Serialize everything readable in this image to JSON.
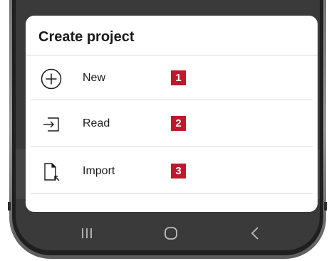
{
  "sheet": {
    "title": "Create project",
    "items": [
      {
        "label": "New",
        "icon": "add-circle-icon",
        "badge": "1"
      },
      {
        "label": "Read",
        "icon": "sign-in-icon",
        "badge": "2"
      },
      {
        "label": "Import",
        "icon": "import-file-icon",
        "badge": "3"
      }
    ]
  },
  "navbar": {
    "buttons": [
      "recent-apps-icon",
      "home-icon",
      "back-icon"
    ]
  },
  "colors": {
    "badge": "#c0172d",
    "sheet_background": "#ffffff",
    "screen_dim": "#3a3a3a"
  }
}
